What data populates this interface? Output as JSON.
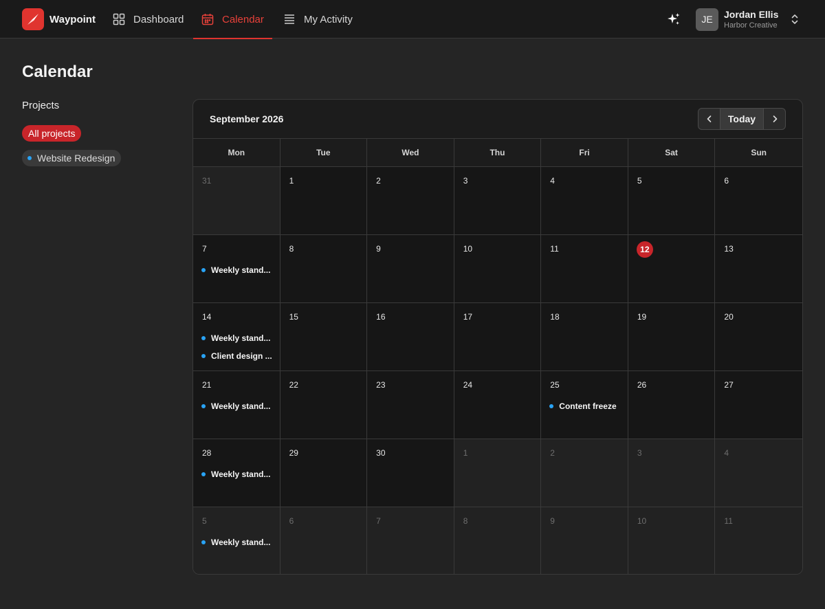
{
  "app": {
    "name": "Waypoint"
  },
  "nav": {
    "items": [
      {
        "label": "Dashboard",
        "icon": "grid-icon"
      },
      {
        "label": "Calendar",
        "icon": "calendar-icon",
        "active": true
      },
      {
        "label": "My Activity",
        "icon": "list-icon"
      }
    ]
  },
  "user": {
    "initials": "JE",
    "name": "Jordan Ellis",
    "org": "Harbor Creative"
  },
  "page": {
    "title": "Calendar"
  },
  "sidebar": {
    "heading": "Projects",
    "filters": {
      "all": "All projects",
      "project": "Website Redesign"
    }
  },
  "colors": {
    "accent": "#c8252a",
    "event_dot": "#29a3f5",
    "background": "#252525"
  },
  "calendar": {
    "month_label": "September 2026",
    "today_label": "Today",
    "weekdays": [
      "Mon",
      "Tue",
      "Wed",
      "Thu",
      "Fri",
      "Sat",
      "Sun"
    ],
    "days": [
      {
        "n": "31",
        "out": true
      },
      {
        "n": "1"
      },
      {
        "n": "2"
      },
      {
        "n": "3"
      },
      {
        "n": "4"
      },
      {
        "n": "5"
      },
      {
        "n": "6"
      },
      {
        "n": "7",
        "events": [
          "Weekly stand..."
        ]
      },
      {
        "n": "8"
      },
      {
        "n": "9"
      },
      {
        "n": "10"
      },
      {
        "n": "11"
      },
      {
        "n": "12",
        "today": true
      },
      {
        "n": "13"
      },
      {
        "n": "14",
        "events": [
          "Weekly stand...",
          "Client design ..."
        ]
      },
      {
        "n": "15"
      },
      {
        "n": "16"
      },
      {
        "n": "17"
      },
      {
        "n": "18"
      },
      {
        "n": "19"
      },
      {
        "n": "20"
      },
      {
        "n": "21",
        "events": [
          "Weekly stand..."
        ]
      },
      {
        "n": "22"
      },
      {
        "n": "23"
      },
      {
        "n": "24"
      },
      {
        "n": "25",
        "events": [
          "Content freeze"
        ]
      },
      {
        "n": "26"
      },
      {
        "n": "27"
      },
      {
        "n": "28",
        "events": [
          "Weekly stand..."
        ]
      },
      {
        "n": "29"
      },
      {
        "n": "30"
      },
      {
        "n": "1",
        "out": true
      },
      {
        "n": "2",
        "out": true
      },
      {
        "n": "3",
        "out": true
      },
      {
        "n": "4",
        "out": true
      },
      {
        "n": "5",
        "out": true,
        "events": [
          "Weekly stand..."
        ]
      },
      {
        "n": "6",
        "out": true
      },
      {
        "n": "7",
        "out": true
      },
      {
        "n": "8",
        "out": true
      },
      {
        "n": "9",
        "out": true
      },
      {
        "n": "10",
        "out": true
      },
      {
        "n": "11",
        "out": true
      }
    ]
  }
}
